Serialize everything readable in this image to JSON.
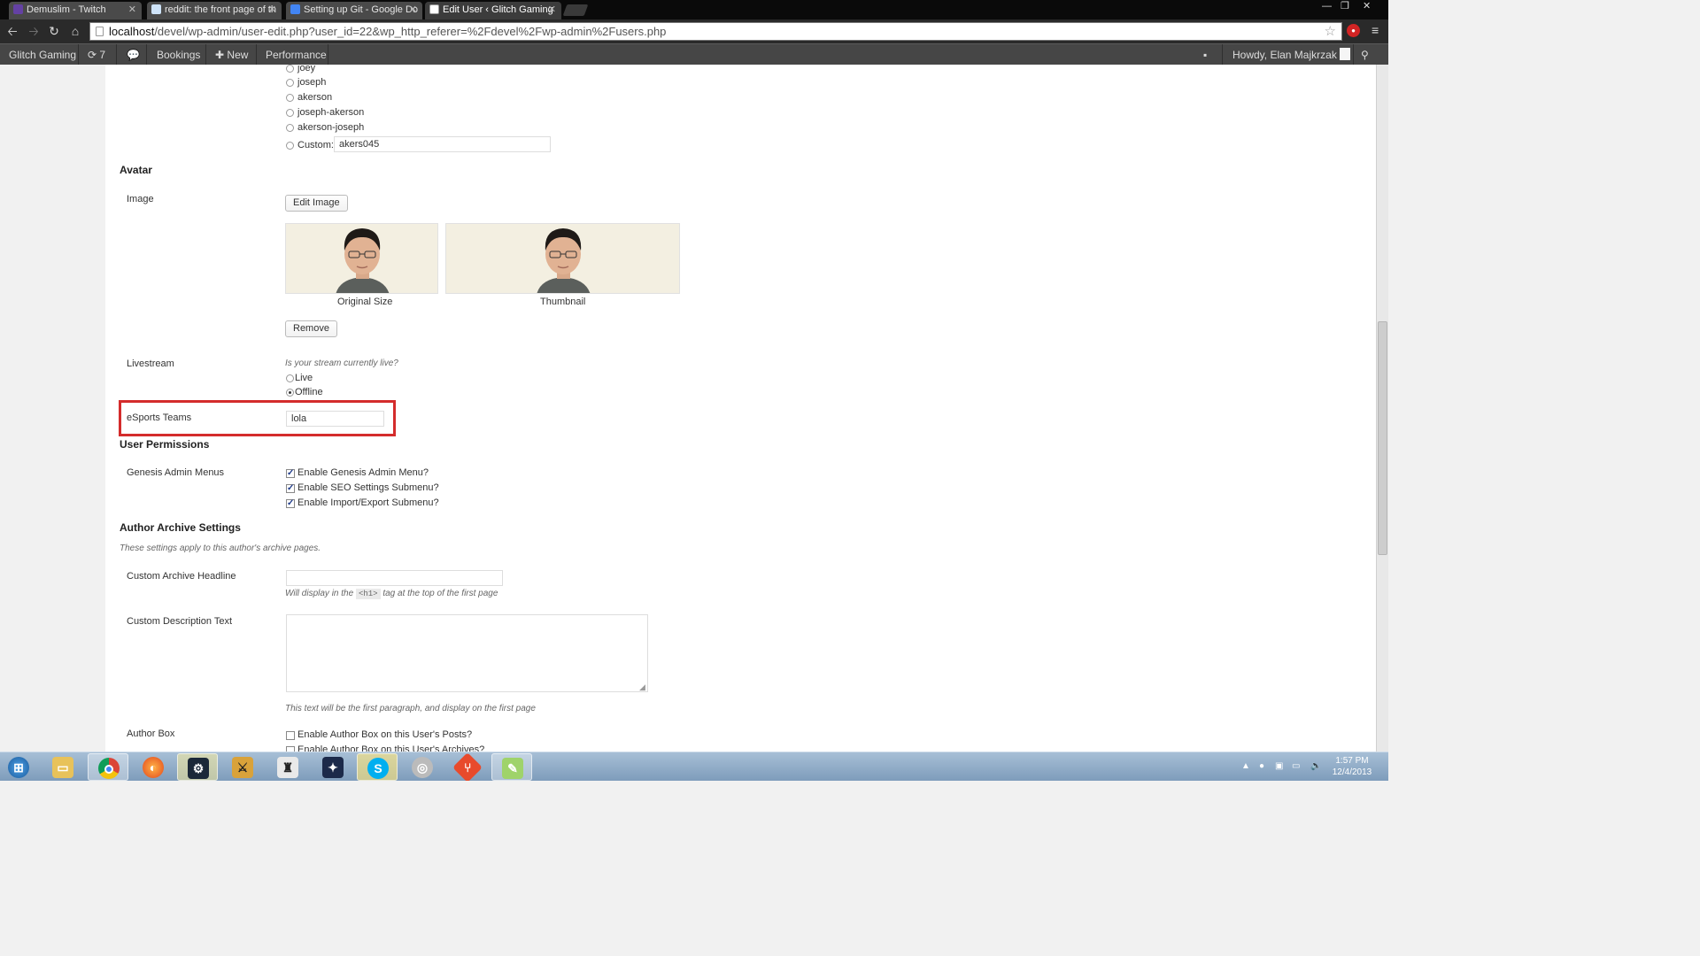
{
  "browser": {
    "tabs": [
      {
        "title": "Demuslim - Twitch",
        "color": "#6441a4"
      },
      {
        "title": "reddit: the front page of th",
        "color": "#cee3f8"
      },
      {
        "title": "Setting up Git - Google Do",
        "color": "#4285f4"
      },
      {
        "title": "Edit User ‹ Glitch Gaming",
        "color": "#ffffff"
      }
    ],
    "url_host": "localhost",
    "url_path": "/devel/wp-admin/user-edit.php?user_id=22&wp_http_referer=%2Fdevel%2Fwp-admin%2Fusers.php"
  },
  "adminbar": {
    "site": "Glitch Gaming",
    "updates": "7",
    "bookings": "Bookings",
    "new": "New",
    "performance": "Performance",
    "howdy": "Howdy, Elan Majkrzak"
  },
  "nickname": {
    "options": [
      "joey",
      "joseph",
      "akerson",
      "joseph-akerson",
      "akerson-joseph"
    ],
    "custom_label": "Custom:",
    "custom_value": "akers045"
  },
  "avatar": {
    "heading": "Avatar",
    "image_label": "Image",
    "edit_button": "Edit Image",
    "original_caption": "Original Size",
    "thumbnail_caption": "Thumbnail",
    "remove_button": "Remove"
  },
  "livestream": {
    "label": "Livestream",
    "question": "Is your stream currently live?",
    "options": [
      "Live",
      "Offline"
    ],
    "selected": "Offline"
  },
  "esports": {
    "label": "eSports Teams",
    "value": "lola"
  },
  "permissions": {
    "heading": "User Permissions",
    "label": "Genesis Admin Menus",
    "options": [
      "Enable Genesis Admin Menu?",
      "Enable SEO Settings Submenu?",
      "Enable Import/Export Submenu?"
    ]
  },
  "archive": {
    "heading": "Author Archive Settings",
    "description": "These settings apply to this author's archive pages.",
    "headline_label": "Custom Archive Headline",
    "headline_desc_pre": "Will display in the",
    "headline_desc_code": "<h1>",
    "headline_desc_post": "tag at the top of the first page",
    "desc_label": "Custom Description Text",
    "desc_help": "This text will be the first paragraph, and display on the first page",
    "authorbox_label": "Author Box",
    "authorbox_options": [
      "Enable Author Box on this User's Posts?",
      "Enable Author Box on this User's Archives?"
    ]
  },
  "taskbar": {
    "time": "1:57 PM",
    "date": "12/4/2013"
  }
}
